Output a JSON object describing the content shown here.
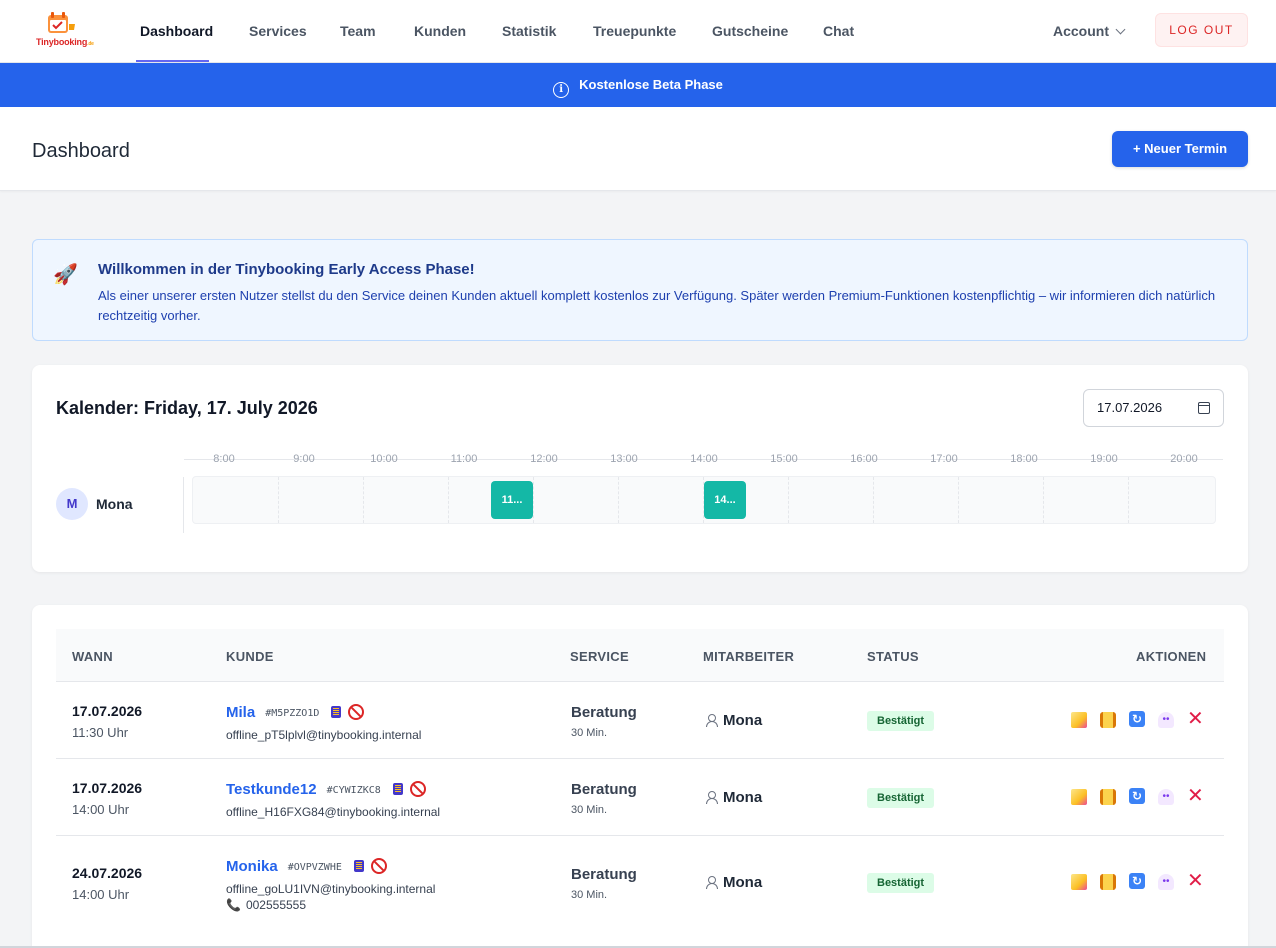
{
  "brand": {
    "name": "Tinybooking",
    "tld": ".de"
  },
  "nav": {
    "items": [
      {
        "label": "Dashboard",
        "active": true
      },
      {
        "label": "Services"
      },
      {
        "label": "Team"
      },
      {
        "label": "Kunden"
      },
      {
        "label": "Statistik"
      },
      {
        "label": "Treuepunkte"
      },
      {
        "label": "Gutscheine"
      },
      {
        "label": "Chat"
      }
    ],
    "account": "Account",
    "logout": "LOG OUT"
  },
  "banner": {
    "text": "Kostenlose Beta Phase",
    "color": "#2563eb"
  },
  "header": {
    "title": "Dashboard",
    "new_button": "+ Neuer Termin"
  },
  "welcome": {
    "title": "Willkommen in der Tinybooking Early Access Phase!",
    "text": "Als einer unserer ersten Nutzer stellst du den Service deinen Kunden aktuell komplett kostenlos zur Verfügung. Später werden Premium-Funktionen kostenpflichtig – wir informieren dich natürlich rechtzeitig vorher."
  },
  "calendar": {
    "title": "Kalender: Friday, 17. July 2026",
    "date_value": "17.07.2026",
    "hours": [
      "8:00",
      "9:00",
      "10:00",
      "11:00",
      "12:00",
      "13:00",
      "14:00",
      "15:00",
      "16:00",
      "17:00",
      "18:00",
      "19:00",
      "20:00"
    ],
    "staff": {
      "initial": "M",
      "name": "Mona"
    },
    "appointments": [
      {
        "label": "11..."
      },
      {
        "label": "14..."
      }
    ]
  },
  "table": {
    "headers": {
      "when": "WANN",
      "customer": "KUNDE",
      "service": "SERVICE",
      "staff": "MITARBEITER",
      "status": "STATUS",
      "actions": "AKTIONEN"
    },
    "rows": [
      {
        "date": "17.07.2026",
        "time": "11:30 Uhr",
        "customer": "Mila",
        "code": "#M5PZZO1D",
        "email": "offline_pT5lplvl@tinybooking.internal",
        "service": "Beratung",
        "duration": "30 Min.",
        "staff": "Mona",
        "status": "Bestätigt"
      },
      {
        "date": "17.07.2026",
        "time": "14:00 Uhr",
        "customer": "Testkunde12",
        "code": "#CYWIZKC8",
        "email": "offline_H16FXG84@tinybooking.internal",
        "service": "Beratung",
        "duration": "30 Min.",
        "staff": "Mona",
        "status": "Bestätigt"
      },
      {
        "date": "24.07.2026",
        "time": "14:00 Uhr",
        "customer": "Monika",
        "code": "#OVPVZWHE",
        "email": "offline_goLU1IVN@tinybooking.internal",
        "phone": "002555555",
        "service": "Beratung",
        "duration": "30 Min.",
        "staff": "Mona",
        "status": "Bestätigt"
      }
    ]
  }
}
